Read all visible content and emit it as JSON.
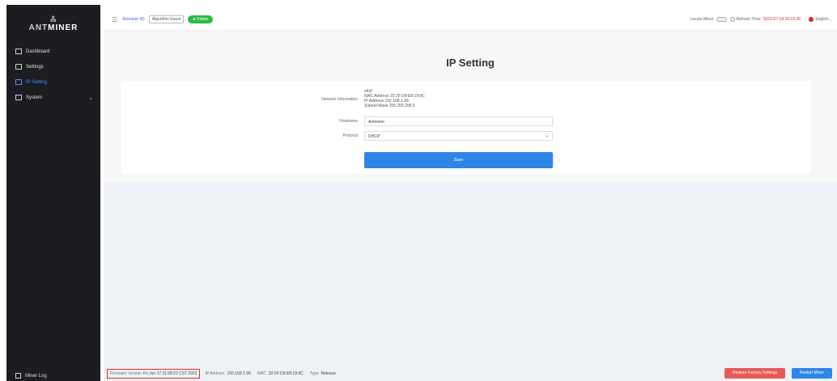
{
  "sidebar": {
    "logo_mark": "Ꮬ",
    "logo_prefix": "ANT",
    "logo_suffix": "MINER",
    "items": [
      {
        "label": "Dashboard",
        "icon": "dashboard-icon"
      },
      {
        "label": "Settings",
        "icon": "settings-icon"
      },
      {
        "label": "IP Setting",
        "icon": "network-icon",
        "active": true
      },
      {
        "label": "System",
        "icon": "system-icon",
        "chevron": "⌄"
      }
    ],
    "miner_log": "Miner Log"
  },
  "topbar": {
    "menu_icon": "☰",
    "model": "Antminer K5",
    "algorithm": "Algorithm Eaum",
    "status": "● Online",
    "locate_miner": "Locate Miner",
    "refresh_label": "Refresh Time:",
    "refresh_time": "2022-07-14 15:15:36",
    "language": "English",
    "language_chevron": "⌄"
  },
  "main": {
    "title": "IP Setting",
    "network_info_label": "Network Information",
    "network_info": {
      "interface": "eth0",
      "mac": "MAC Address 22:2F:D9:E8:19:9C",
      "ip": "IP Address 192.168.1.99",
      "subnet": "Subnet Mask 255.255.255.0"
    },
    "hostname_label": "Hostname",
    "hostname_value": "Antminer",
    "protocol_label": "Protocol",
    "protocol_value": "DHCP",
    "protocol_caret": "⌄",
    "save_label": "Save"
  },
  "footer": {
    "firmware_label": "Firmware Version",
    "firmware_value": "Fri Jun 17 11:28:22 CST 2022",
    "ip_label": "IP Address",
    "ip_value": "192.168.1.99",
    "mac_label": "MAC",
    "mac_value": "22:2F:D9:E8:19:9C",
    "type_label": "Type",
    "type_value": "Release",
    "reset_label": "Restore Factory Settings",
    "restart_label": "Restart Miner"
  },
  "colors": {
    "sidebar_bg": "#1c1d20",
    "accent": "#2e86e6",
    "online": "#2db84b",
    "danger": "#e65a5a",
    "highlight_border": "#d93030"
  }
}
